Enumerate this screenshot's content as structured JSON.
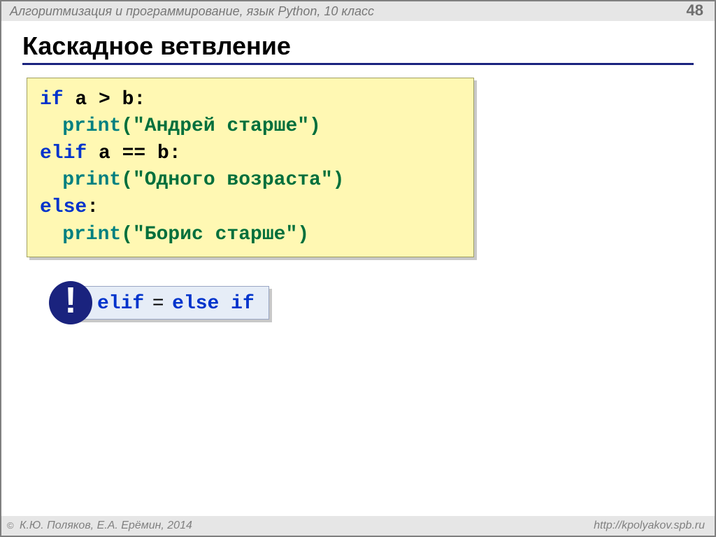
{
  "header": {
    "course_title": "Алгоритмизация и программирование, язык Python, 10 класс",
    "page_number": "48"
  },
  "title": "Каскадное ветвление",
  "code": {
    "kw_if": "if",
    "cond1": " a > b:",
    "fn_print1": "print",
    "str_andrey": "(\"Андрей старше\")",
    "kw_elif": "elif",
    "cond2": " a == b:",
    "fn_print2": "print",
    "str_same": "(\"Одного возраста\")",
    "kw_else": "else",
    "colon": ":",
    "fn_print3": "print",
    "str_boris": "(\"Борис старше\")"
  },
  "note": {
    "badge": "!",
    "elif": "elif",
    "equals": " = ",
    "else_if": "else if"
  },
  "footer": {
    "authors": " К.Ю. Поляков, Е.А. Ерёмин, 2014",
    "url": "http://kpolyakov.spb.ru"
  }
}
